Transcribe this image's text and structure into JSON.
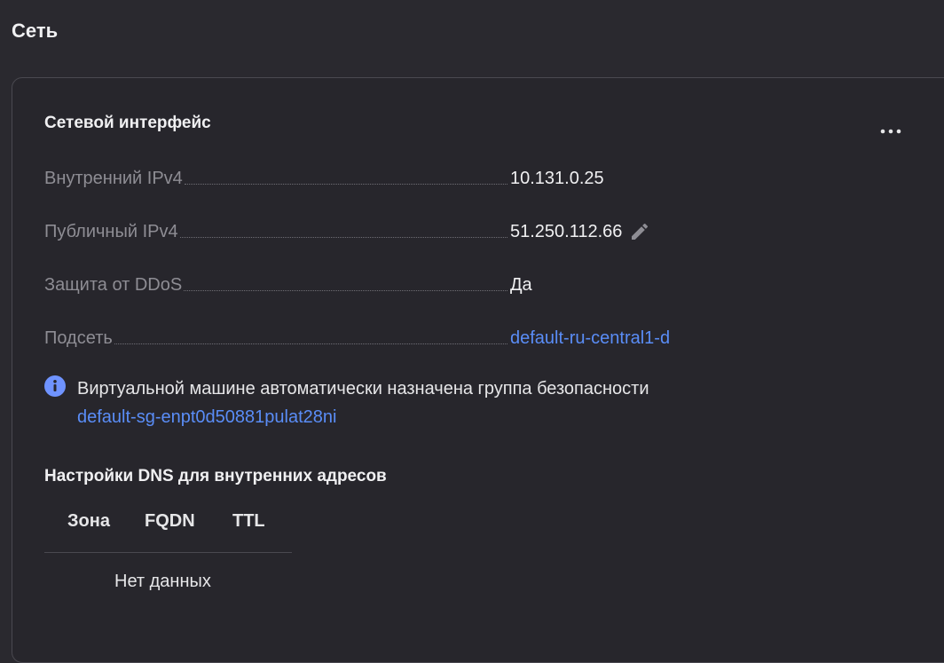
{
  "section": {
    "title": "Сеть"
  },
  "network_interface": {
    "title": "Сетевой интерфейс",
    "more_icon": "more-horizontal-icon",
    "properties": [
      {
        "label": "Внутренний IPv4",
        "value": "10.131.0.25",
        "type": "text"
      },
      {
        "label": "Публичный IPv4",
        "value": "51.250.112.66",
        "type": "text-editable",
        "icon": "pencil-icon"
      },
      {
        "label": "Защита от DDoS",
        "value": "Да",
        "type": "text"
      },
      {
        "label": "Подсеть",
        "value": "default-ru-central1-d",
        "type": "link"
      }
    ],
    "security_notice": {
      "icon": "info-icon",
      "text": "Виртуальной машине автоматически назначена группа безопасности",
      "link": "default-sg-enpt0d50881pulat28ni"
    }
  },
  "dns": {
    "title": "Настройки DNS для внутренних адресов",
    "columns": [
      "Зона",
      "FQDN",
      "TTL"
    ],
    "empty_text": "Нет данных"
  },
  "colors": {
    "background": "#2a292f",
    "card_border": "#4a4950",
    "link": "#5a8df7",
    "info_icon": "#6f93ff",
    "label": "#8e8d94",
    "value": "#f0f0f2"
  }
}
